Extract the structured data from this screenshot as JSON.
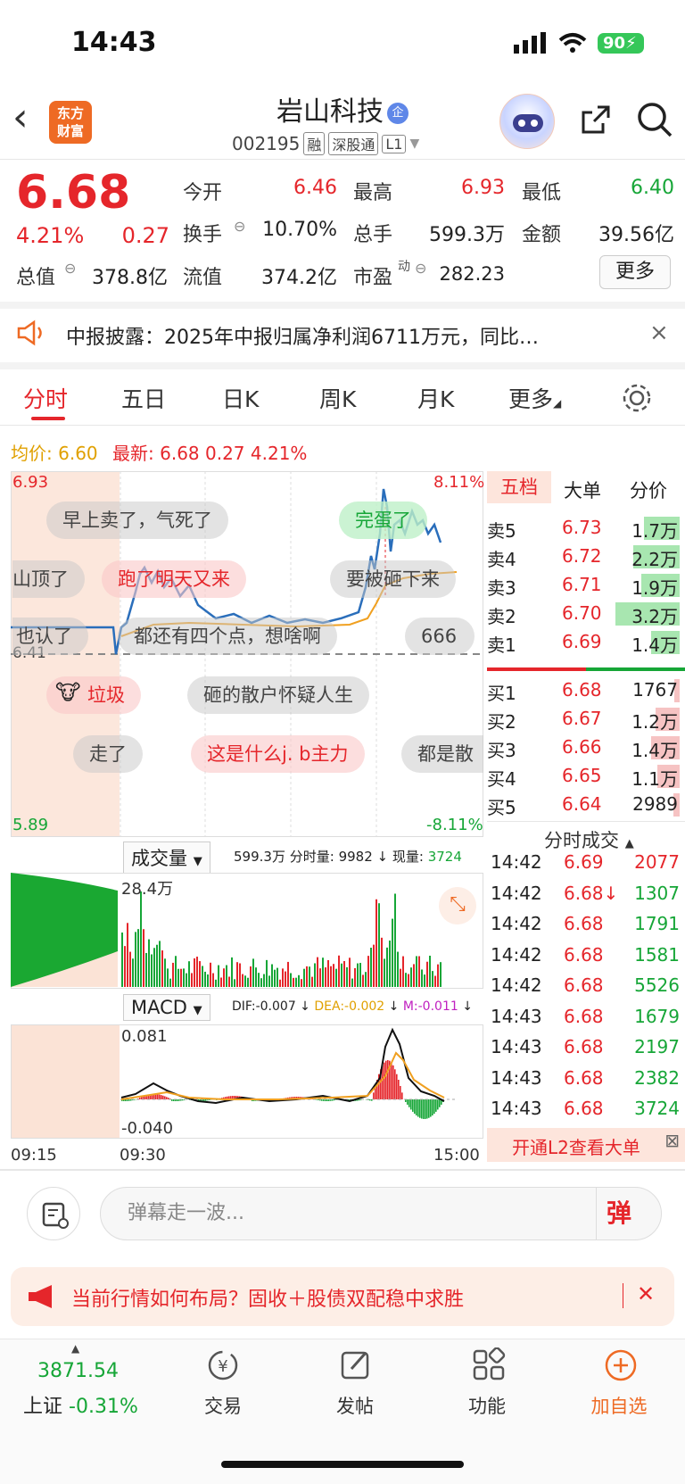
{
  "status": {
    "time": "14:43",
    "battery": "90"
  },
  "header": {
    "name": "岩山科技",
    "badge": "企",
    "code": "002195",
    "tags": [
      "融",
      "深股通",
      "L1"
    ]
  },
  "quote": {
    "price": "6.68",
    "pct": "4.21%",
    "change": "0.27",
    "rows": [
      [
        {
          "l": "今开",
          "v": "6.46",
          "c": "red"
        },
        {
          "l": "最高",
          "v": "6.93",
          "c": "red"
        },
        {
          "l": "最低",
          "v": "6.40",
          "c": "green"
        }
      ],
      [
        {
          "l": "换手",
          "v": "10.70%",
          "c": "dark"
        },
        {
          "l": "总手",
          "v": "599.3万",
          "c": "dark"
        },
        {
          "l": "金额",
          "v": "39.56亿",
          "c": "dark"
        }
      ],
      [
        {
          "l": "流值",
          "v": "374.2亿",
          "c": "dark"
        },
        {
          "l": "市盈",
          "v": "282.23",
          "c": "dark"
        }
      ]
    ],
    "total_label": "总值",
    "total_value": "378.8亿",
    "pe_sup": "动",
    "more": "更多"
  },
  "notice": {
    "text": "中报披露：2025年中报归属净利润6711万元，同比…",
    "close": "×"
  },
  "tabs": [
    "分时",
    "五日",
    "日K",
    "周K",
    "月K",
    "更多"
  ],
  "info": {
    "avg_label": "均价:",
    "avg": "6.60",
    "latest_label": "最新:",
    "latest": "6.68",
    "chg": "0.27",
    "pct": "4.21%"
  },
  "chart": {
    "hi": "6.93",
    "lo": "5.89",
    "prev": "6.41",
    "hi_pct": "8.11%",
    "lo_pct": "-8.11%",
    "danmu": [
      "完蛋了",
      "早上卖了，气死了",
      "山顶了",
      "跑了明天又来",
      "要被砸下来",
      "也认了",
      "都还有四个点，想啥啊",
      "666",
      "垃圾",
      "砸的散户怀疑人生",
      "走了",
      "这是什么j. b主力",
      "都是散"
    ]
  },
  "five": {
    "tabs": [
      "五档",
      "大单",
      "分价"
    ],
    "asks": [
      {
        "l": "卖5",
        "p": "6.73",
        "v": "1.7万",
        "w": 0.55
      },
      {
        "l": "卖4",
        "p": "6.72",
        "v": "2.2万",
        "w": 0.72
      },
      {
        "l": "卖3",
        "p": "6.71",
        "v": "1.9万",
        "w": 0.6
      },
      {
        "l": "卖2",
        "p": "6.70",
        "v": "3.2万",
        "w": 1.0
      },
      {
        "l": "卖1",
        "p": "6.69",
        "v": "1.4万",
        "w": 0.45
      }
    ],
    "bids": [
      {
        "l": "买1",
        "p": "6.68",
        "v": "1767",
        "w": 0.08
      },
      {
        "l": "买2",
        "p": "6.67",
        "v": "1.2万",
        "w": 0.38
      },
      {
        "l": "买3",
        "p": "6.66",
        "v": "1.4万",
        "w": 0.45
      },
      {
        "l": "买4",
        "p": "6.65",
        "v": "1.1万",
        "w": 0.35
      },
      {
        "l": "买5",
        "p": "6.64",
        "v": "2989",
        "w": 0.1
      }
    ]
  },
  "ticks": {
    "title": "分时成交",
    "rows": [
      [
        "14:42",
        "6.69",
        "2077"
      ],
      [
        "14:42",
        "6.68↓",
        "1307"
      ],
      [
        "14:42",
        "6.68",
        "1791"
      ],
      [
        "14:42",
        "6.68",
        "1581"
      ],
      [
        "14:42",
        "6.68",
        "5526"
      ],
      [
        "14:43",
        "6.68",
        "1679"
      ],
      [
        "14:43",
        "6.68",
        "2197"
      ],
      [
        "14:43",
        "6.68",
        "2382"
      ],
      [
        "14:43",
        "6.68",
        "3724"
      ]
    ],
    "l2": "开通L2查看大单"
  },
  "volume": {
    "select": "成交量",
    "total": "599.3万",
    "fs_label": "分时量:",
    "fs": "9982",
    "cur_label": "现量:",
    "cur": "3724",
    "max": "28.4万"
  },
  "macd": {
    "select": "MACD",
    "dif": "DIF:-0.007",
    "dea": "DEA:-0.002",
    "m": "M:-0.011",
    "top": "0.081",
    "bottom": "-0.040"
  },
  "time_axis": [
    "09:15",
    "09:30",
    "15:00"
  ],
  "danmu_input": {
    "placeholder": "弹幕走一波..."
  },
  "promo": {
    "text": "当前行情如何布局？固收＋股债双配稳中求胜"
  },
  "nav": {
    "index_value": "3871.54",
    "index_name": "上证",
    "index_pct": "-0.31%",
    "items": [
      "交易",
      "发帖",
      "功能",
      "加自选"
    ]
  }
}
